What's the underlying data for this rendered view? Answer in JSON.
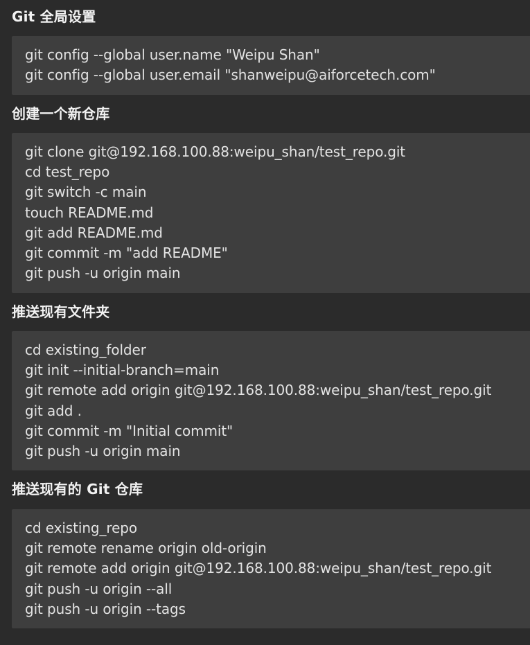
{
  "sections": [
    {
      "title": "Git 全局设置",
      "lines": [
        "git config --global user.name \"Weipu Shan\"",
        "git config --global user.email \"shanweipu@aiforcetech.com\""
      ]
    },
    {
      "title": "创建一个新仓库",
      "lines": [
        "git clone git@192.168.100.88:weipu_shan/test_repo.git",
        "cd test_repo",
        "git switch -c main",
        "touch README.md",
        "git add README.md",
        "git commit -m \"add README\"",
        "git push -u origin main"
      ]
    },
    {
      "title": "推送现有文件夹",
      "lines": [
        "cd existing_folder",
        "git init --initial-branch=main",
        "git remote add origin git@192.168.100.88:weipu_shan/test_repo.git",
        "git add .",
        "git commit -m \"Initial commit\"",
        "git push -u origin main"
      ]
    },
    {
      "title": "推送现有的 Git 仓库",
      "lines": [
        "cd existing_repo",
        "git remote rename origin old-origin",
        "git remote add origin git@192.168.100.88:weipu_shan/test_repo.git",
        "git push -u origin --all",
        "git push -u origin --tags"
      ]
    }
  ],
  "colors": {
    "background": "#2b2b2b",
    "code_background": "#3e3e3e",
    "title_text": "#f2f2f2",
    "code_text": "#e3e3e3"
  }
}
